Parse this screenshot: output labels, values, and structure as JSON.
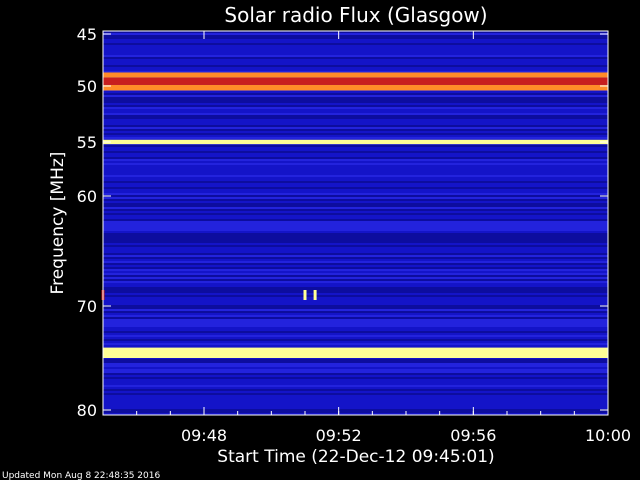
{
  "chart_data": {
    "type": "heatmap",
    "title": "Solar radio Flux (Glasgow)",
    "xlabel": "Start Time (22-Dec-12 09:45:01)",
    "ylabel": "Frequency [MHz]",
    "footer": "Updated Mon Aug  8 22:48:35 2016",
    "x_unit": "minutes after 09:45",
    "xlim": [
      0.0,
      15.0
    ],
    "ylim": [
      45,
      80
    ],
    "x_ticks": [
      {
        "value": 3.0,
        "label": "09:48"
      },
      {
        "value": 7.0,
        "label": "09:52"
      },
      {
        "value": 11.0,
        "label": "09:56"
      },
      {
        "value": 15.0,
        "label": "10:00"
      }
    ],
    "y_ticks": [
      {
        "value": 45,
        "label": "45"
      },
      {
        "value": 50,
        "label": "50"
      },
      {
        "value": 55,
        "label": "55"
      },
      {
        "value": 60,
        "label": "60"
      },
      {
        "value": 70,
        "label": "70"
      },
      {
        "value": 80,
        "label": "80"
      }
    ],
    "colors": {
      "background": "#000000",
      "base": "#1414c8",
      "dark": "#0a0a8c",
      "light": "#2a2ae6",
      "red": "#c81e1e",
      "orange": "#ff8c28",
      "yellow": "#ffff96"
    },
    "bands": [
      {
        "from": 48.7,
        "to": 49.2,
        "level": "orange"
      },
      {
        "from": 49.2,
        "to": 49.9,
        "level": "red"
      },
      {
        "from": 49.9,
        "to": 50.4,
        "level": "orange"
      },
      {
        "from": 54.8,
        "to": 55.2,
        "level": "yellow"
      },
      {
        "from": 74.0,
        "to": 75.0,
        "level": "yellow"
      }
    ],
    "bursts": [
      {
        "t": 6.0,
        "f": 69.0,
        "level": "yellow"
      },
      {
        "t": 6.3,
        "f": 69.0,
        "level": "yellow"
      },
      {
        "t": 0.0,
        "f": 69.0,
        "level": "red"
      }
    ]
  }
}
